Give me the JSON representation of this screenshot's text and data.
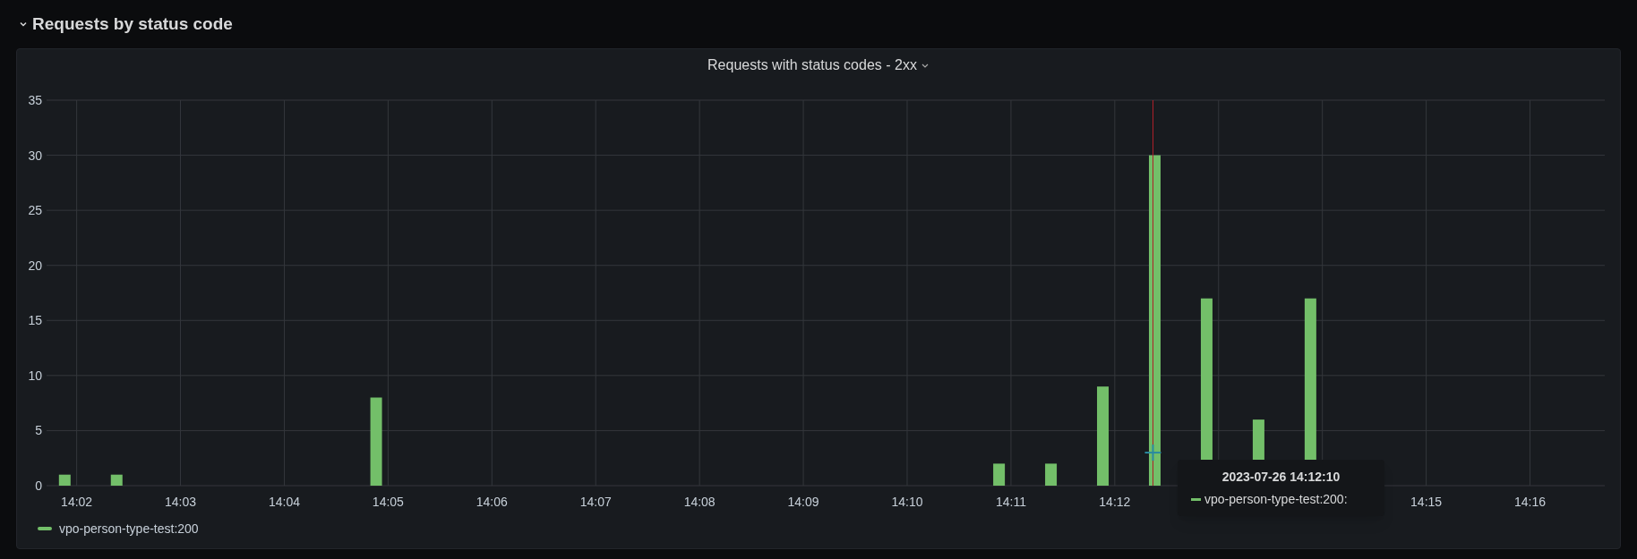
{
  "row": {
    "title": "Requests by status code",
    "expanded": true
  },
  "panel": {
    "title": "Requests with status codes - 2xx",
    "chart_data": {
      "type": "bar",
      "categories": [
        null,
        "14:02",
        null,
        null,
        null,
        null,
        null,
        "14:03",
        null,
        null,
        null,
        null,
        null,
        "14:04",
        null,
        null,
        null,
        null,
        null,
        "14:05",
        null,
        null,
        null,
        null,
        null,
        "14:06",
        null,
        null,
        null,
        null,
        null,
        "14:07",
        null,
        null,
        null,
        null,
        null,
        "14:08",
        null,
        null,
        null,
        null,
        null,
        "14:09",
        null,
        null,
        null,
        null,
        null,
        "14:10",
        null,
        null,
        null,
        null,
        null,
        "14:11",
        null,
        null,
        null,
        null,
        null,
        "14:12",
        null,
        null,
        null,
        null,
        null,
        null,
        null,
        null,
        null,
        null,
        null,
        null,
        null,
        null,
        null,
        null,
        null,
        "14:15",
        null,
        null,
        null,
        null,
        null,
        "14:16",
        null,
        null,
        null,
        null
      ],
      "series": [
        {
          "name": "vpo-person-type-test:200",
          "color": "#73bf69",
          "values": [
            1,
            null,
            null,
            1,
            null,
            null,
            null,
            null,
            null,
            null,
            null,
            null,
            null,
            null,
            null,
            null,
            null,
            null,
            8,
            null,
            null,
            null,
            null,
            null,
            null,
            null,
            null,
            null,
            null,
            null,
            null,
            null,
            null,
            null,
            null,
            null,
            null,
            null,
            null,
            null,
            null,
            null,
            null,
            null,
            null,
            null,
            null,
            null,
            null,
            null,
            null,
            null,
            null,
            null,
            2,
            null,
            null,
            2,
            null,
            null,
            9,
            null,
            null,
            30,
            null,
            null,
            17,
            null,
            null,
            6,
            null,
            null,
            17,
            null,
            null,
            null,
            null,
            null,
            null,
            null,
            null,
            null,
            null,
            null,
            null,
            null,
            null,
            null,
            null,
            null
          ]
        }
      ],
      "grid": true,
      "ylim": [
        0,
        35
      ],
      "yticks": [
        0,
        5,
        10,
        15,
        20,
        25,
        30,
        35
      ]
    },
    "tooltip": {
      "title": "2023-07-26 14:12:10",
      "series": [
        {
          "name": "vpo-person-type-test:200:",
          "color": "#73bf69"
        }
      ]
    }
  }
}
